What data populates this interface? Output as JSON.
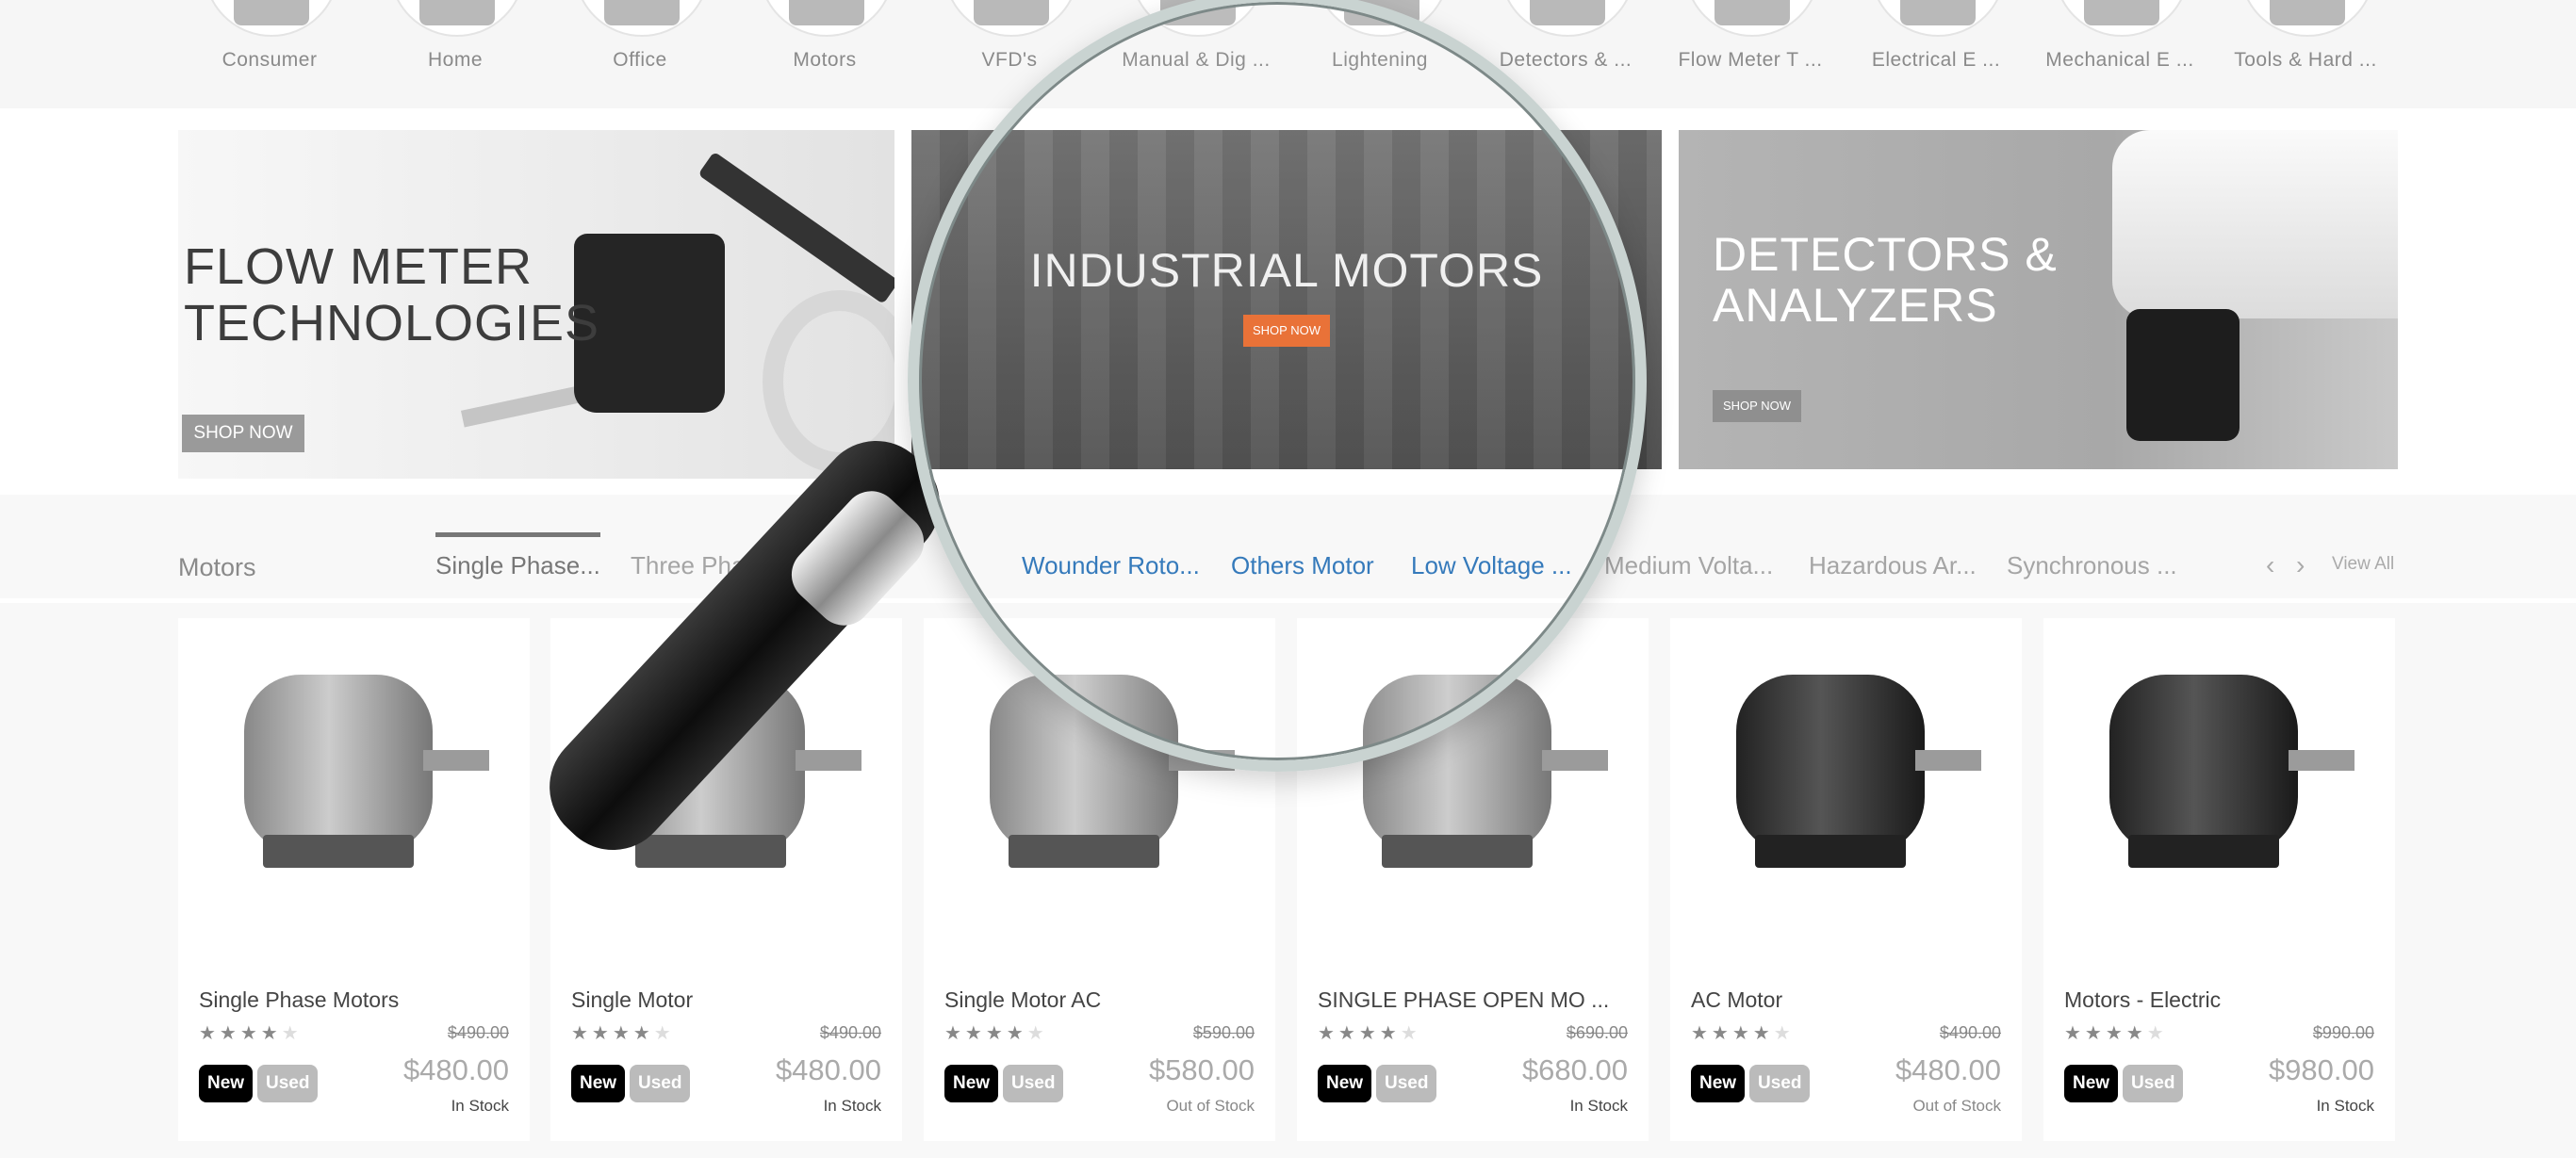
{
  "categories": [
    {
      "label": "Consumer"
    },
    {
      "label": "Home"
    },
    {
      "label": "Office"
    },
    {
      "label": "Motors"
    },
    {
      "label": "VFD's"
    },
    {
      "label": "Manual & Dig ..."
    },
    {
      "label": "Lightening"
    },
    {
      "label": "Detectors & ..."
    },
    {
      "label": "Flow Meter T ..."
    },
    {
      "label": "Electrical E ..."
    },
    {
      "label": "Mechanical E ..."
    },
    {
      "label": "Tools & Hard ..."
    }
  ],
  "banners": {
    "flow": {
      "line1": "FLOW METER",
      "line2": "TECHNOLOGIES",
      "button": "SHOP NOW"
    },
    "motors": {
      "title": "INDUSTRIAL MOTORS",
      "button": "SHOP NOW",
      "accent": "#e86b2e"
    },
    "detectors": {
      "line1": "DETECTORS &",
      "line2": "ANALYZERS",
      "button": "SHOP NOW"
    }
  },
  "section": {
    "title": "Motors",
    "tabs": [
      {
        "label": "Single Phase..."
      },
      {
        "label": "Three Phase ..."
      },
      {
        "label": "Wounder Roto..."
      },
      {
        "label": "Others Motor"
      },
      {
        "label": "Low Voltage ..."
      },
      {
        "label": "Medium Volta..."
      },
      {
        "label": "Hazardous Ar..."
      },
      {
        "label": "Synchronous ..."
      }
    ],
    "prev_icon": "‹",
    "next_icon": "›",
    "view_all": "View All",
    "link_color": "#2b73b8"
  },
  "products": [
    {
      "name": "Single Phase Motors",
      "old_price": "$490.00",
      "price": "$480.00",
      "new": "New",
      "used": "Used",
      "stock": "In Stock",
      "rating": 4
    },
    {
      "name": "Single Motor",
      "old_price": "$490.00",
      "price": "$480.00",
      "new": "New",
      "used": "Used",
      "stock": "In Stock",
      "rating": 4
    },
    {
      "name": "Single Motor AC",
      "old_price": "$590.00",
      "price": "$580.00",
      "new": "New",
      "used": "Used",
      "stock": "Out of Stock",
      "rating": 4
    },
    {
      "name": "SINGLE PHASE OPEN MO ...",
      "old_price": "$690.00",
      "price": "$680.00",
      "new": "New",
      "used": "Used",
      "stock": "In Stock",
      "rating": 4
    },
    {
      "name": "AC Motor",
      "old_price": "$490.00",
      "price": "$480.00",
      "new": "New",
      "used": "Used",
      "stock": "Out of Stock",
      "rating": 4
    },
    {
      "name": "Motors - Electric",
      "old_price": "$990.00",
      "price": "$980.00",
      "new": "New",
      "used": "Used",
      "stock": "In Stock",
      "rating": 4
    }
  ]
}
